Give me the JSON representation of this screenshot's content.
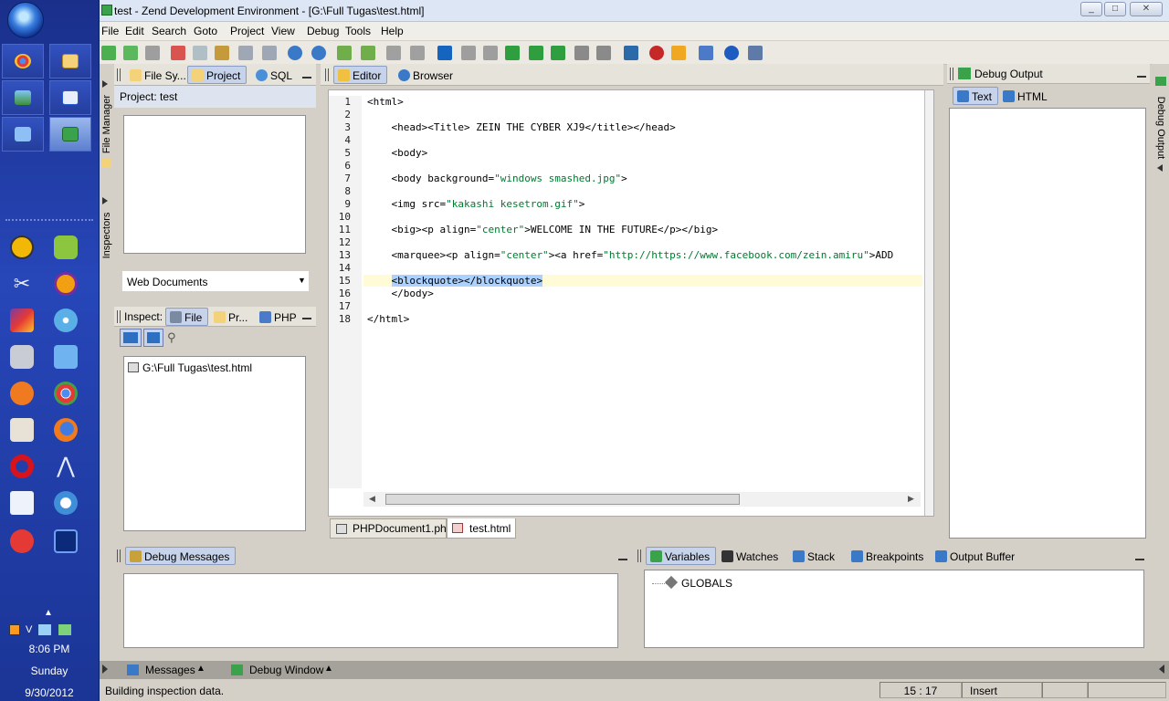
{
  "taskbar": {
    "clock_time": "8:06 PM",
    "clock_day": "Sunday",
    "clock_date": "9/30/2012"
  },
  "window": {
    "title": "test - Zend Development Environment - [G:\\Full Tugas\\test.html]",
    "min": "▭",
    "max": "▭",
    "close": "✕"
  },
  "menu": [
    "File",
    "Edit",
    "Search",
    "Goto",
    "Project",
    "View",
    "Debug",
    "Tools",
    "Help"
  ],
  "left_panel": {
    "tabs": [
      "File Sy...",
      "Project",
      "SQL"
    ],
    "project_label": "Project: test",
    "dropdown_value": "Web Documents",
    "side_labels": [
      "File Manager",
      "Inspectors"
    ]
  },
  "inspect_panel": {
    "label": "Inspect:",
    "tabs": [
      "File",
      "Pr...",
      "PHP"
    ],
    "tree_item": "G:\\Full Tugas\\test.html"
  },
  "editor": {
    "tabs": [
      "Editor",
      "Browser"
    ],
    "lines": [
      {
        "n": "1",
        "parts": [
          [
            "<html>",
            ""
          ]
        ]
      },
      {
        "n": "2",
        "parts": []
      },
      {
        "n": "3",
        "parts": [
          [
            "    <head><Title> ZEIN THE CYBER XJ9</title></head>",
            ""
          ]
        ]
      },
      {
        "n": "4",
        "parts": []
      },
      {
        "n": "5",
        "parts": [
          [
            "    <body>",
            ""
          ]
        ]
      },
      {
        "n": "6",
        "parts": []
      },
      {
        "n": "7",
        "parts": [
          [
            "    <body background=",
            ""
          ],
          [
            "\"windows smashed.jpg\"",
            "str"
          ],
          [
            ">",
            ""
          ]
        ]
      },
      {
        "n": "8",
        "parts": []
      },
      {
        "n": "9",
        "parts": [
          [
            "    <img src=",
            ""
          ],
          [
            "\"kakashi kesetrom.gif\"",
            "str"
          ],
          [
            ">",
            ""
          ]
        ]
      },
      {
        "n": "10",
        "parts": []
      },
      {
        "n": "11",
        "parts": [
          [
            "    <big><p align=",
            ""
          ],
          [
            "\"center\"",
            "str"
          ],
          [
            ">WELCOME IN THE FUTURE</p></big>",
            ""
          ]
        ]
      },
      {
        "n": "12",
        "parts": []
      },
      {
        "n": "13",
        "parts": [
          [
            "    <marquee><p align=",
            ""
          ],
          [
            "\"center\"",
            "str"
          ],
          [
            "><a href=",
            ""
          ],
          [
            "\"http://https://www.facebook.com/zein.amiru\"",
            "str"
          ],
          [
            ">ADD",
            ""
          ]
        ]
      },
      {
        "n": "14",
        "parts": []
      },
      {
        "n": "15",
        "parts": [
          [
            "    ",
            ""
          ],
          [
            "<blockquote>",
            "sel"
          ],
          [
            "</blockquote>",
            "sel"
          ]
        ]
      },
      {
        "n": "16",
        "parts": [
          [
            "    </body>",
            ""
          ]
        ]
      },
      {
        "n": "17",
        "parts": []
      },
      {
        "n": "18",
        "parts": [
          [
            "</html>",
            ""
          ]
        ]
      }
    ],
    "file_tabs": [
      "PHPDocument1.php",
      "test.html"
    ]
  },
  "debug_output": {
    "title": "Debug Output",
    "tabs": [
      "Text",
      "HTML"
    ],
    "side_label": "Debug Output"
  },
  "debug_messages": {
    "tab": "Debug Messages"
  },
  "variables_panel": {
    "tabs": [
      "Variables",
      "Watches",
      "Stack",
      "Breakpoints",
      "Output Buffer"
    ],
    "tree_item": "GLOBALS"
  },
  "bottom_bar": {
    "messages": "Messages",
    "debug_window": "Debug Window"
  },
  "statusbar": {
    "message": "Building inspection data.",
    "position": "15 : 17",
    "mode": "Insert"
  },
  "colors": {
    "string": "#007a2e",
    "selection": "#aad1ff",
    "current_line": "#fffbd6",
    "active_tab": "#c6d3ea"
  }
}
